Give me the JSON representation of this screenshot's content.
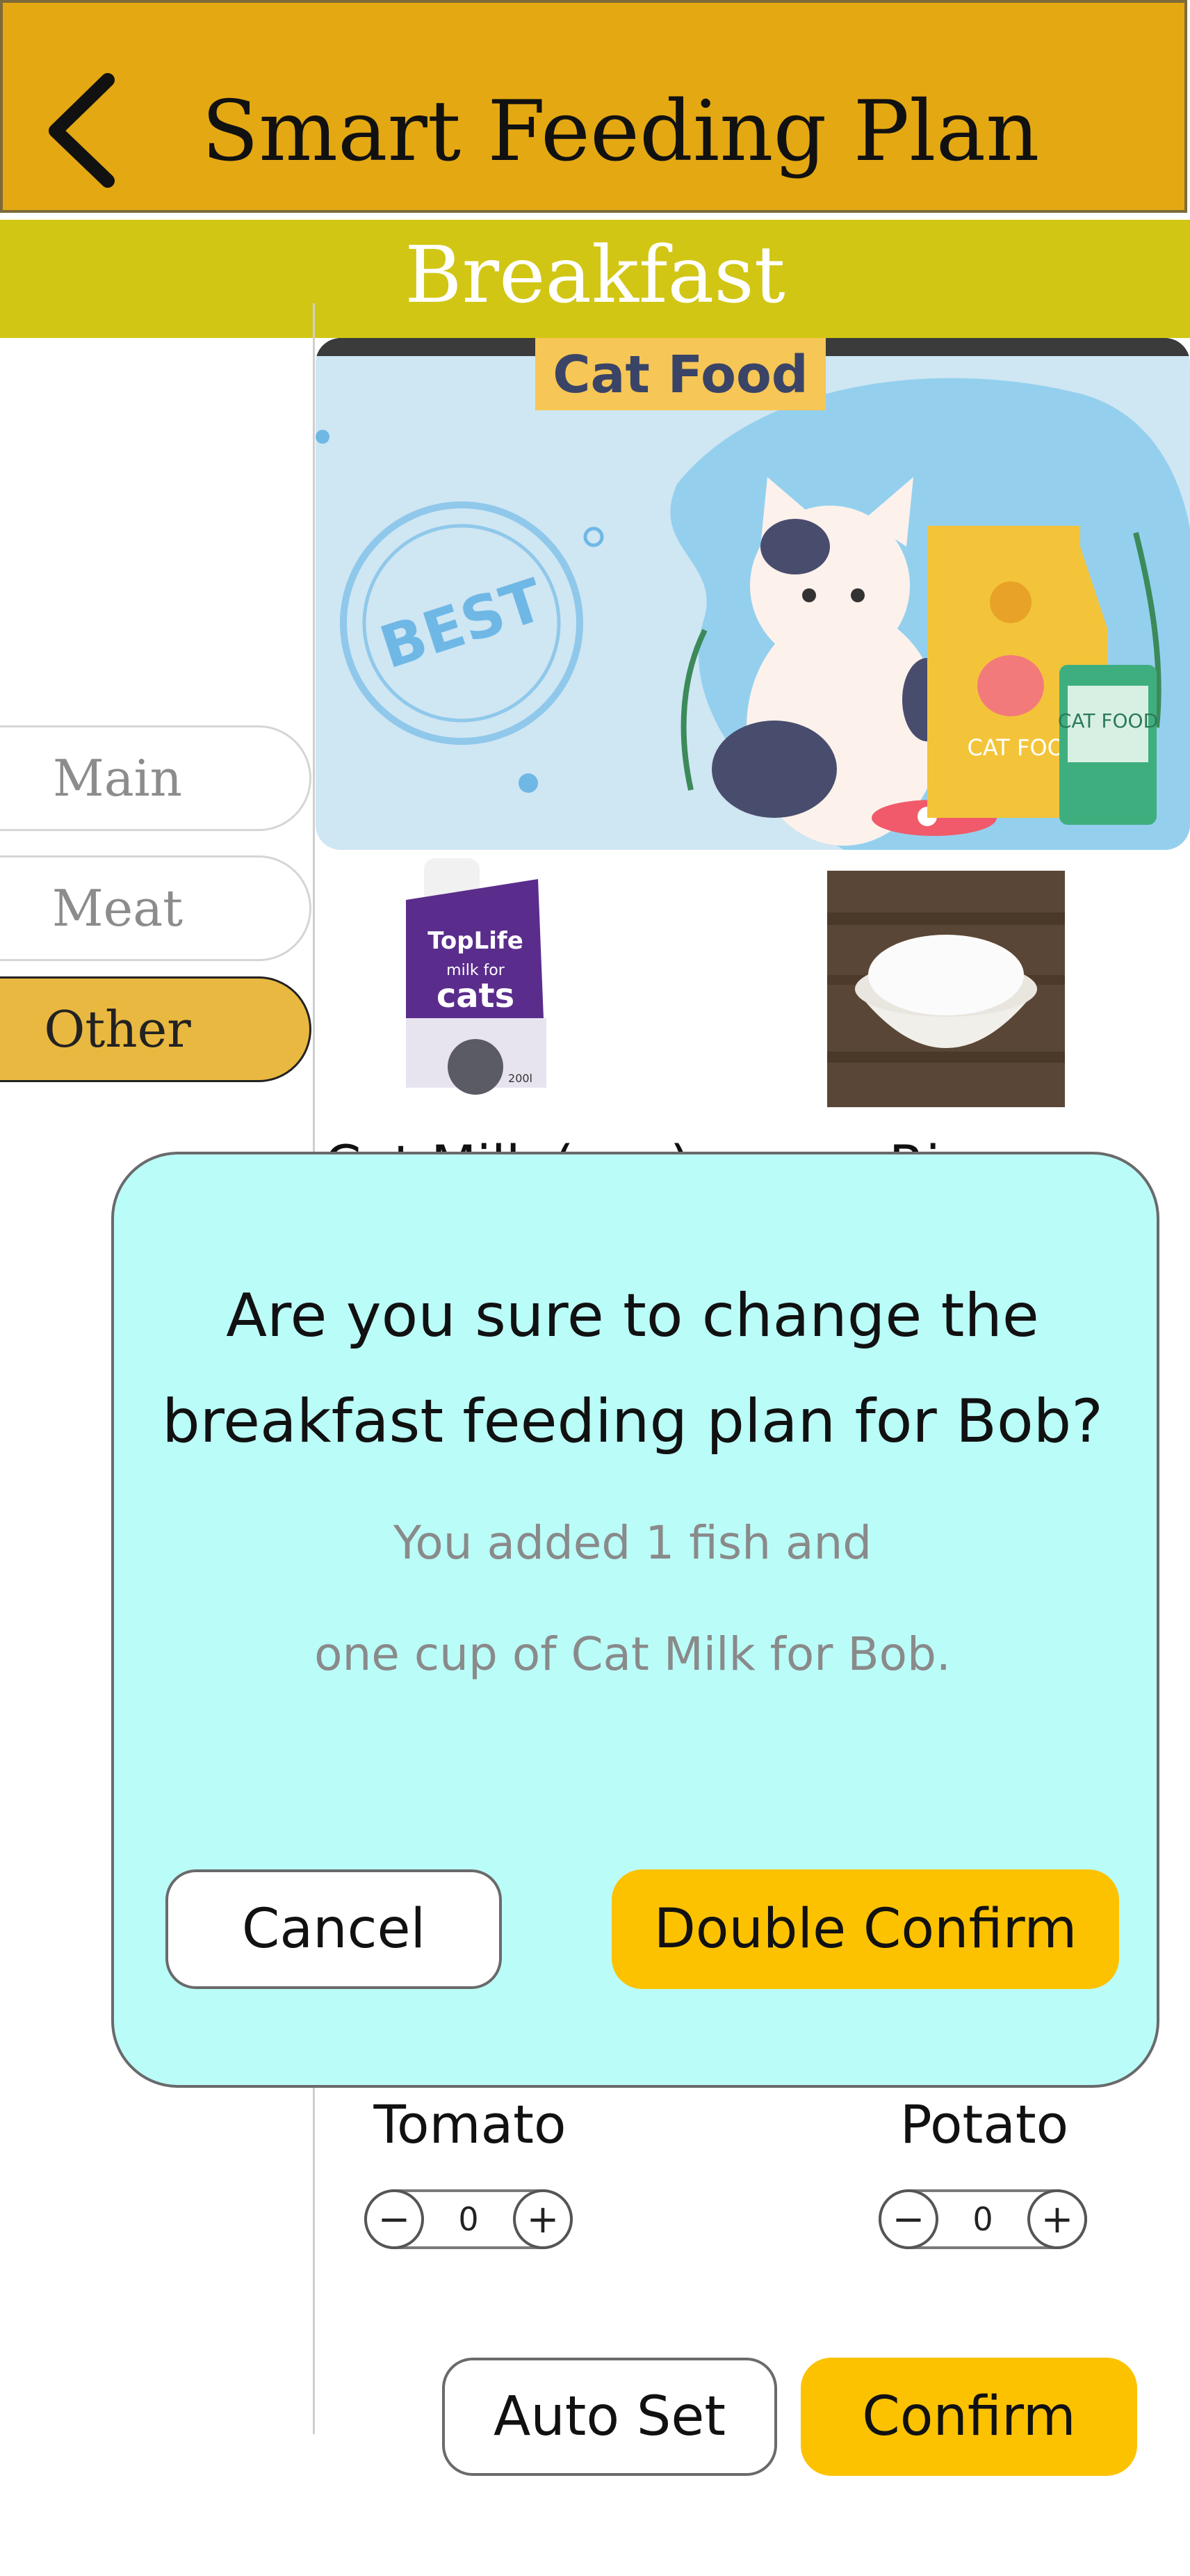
{
  "header": {
    "title": "Smart Feeding Plan",
    "back_icon": "chevron-left-icon"
  },
  "meal": "Breakfast",
  "categories": [
    {
      "label": "Main",
      "selected": false
    },
    {
      "label": "Meat",
      "selected": false
    },
    {
      "label": "Other",
      "selected": true
    }
  ],
  "banner": {
    "title": "Cat Food",
    "stamp": "BEST",
    "bag_text_1": "CAT FOOD",
    "bag_text_2": "CAT FOOD"
  },
  "products": [
    {
      "name": "Cat Milk (cup)",
      "pack_brand": "TopLife",
      "pack_title_1": "milk for",
      "pack_title_2": "cats",
      "pack_size": "200l"
    },
    {
      "name": "Rice"
    }
  ],
  "dialog": {
    "question": "Are you sure to change the breakfast feeding plan for Bob?",
    "question_line1": "Are you sure to change the",
    "question_line2": "breakfast feeding plan for Bob?",
    "detail_line1": "You added 1 fish and",
    "detail_line2": "one cup of Cat Milk for Bob.",
    "cancel_label": "Cancel",
    "confirm_label": "Double Confirm"
  },
  "items": [
    {
      "name": "Tomato",
      "quantity": "0",
      "minus": "−",
      "plus": "+"
    },
    {
      "name": "Potato",
      "quantity": "0",
      "minus": "−",
      "plus": "+"
    }
  ],
  "footer": {
    "autoset_label": "Auto Set",
    "confirm_label": "Confirm"
  },
  "colors": {
    "header": "#e4a812",
    "meal_bar": "#d1c614",
    "dialog_bg": "#bafcf8",
    "accent": "#fcc200",
    "selected_category": "#e8b840"
  }
}
